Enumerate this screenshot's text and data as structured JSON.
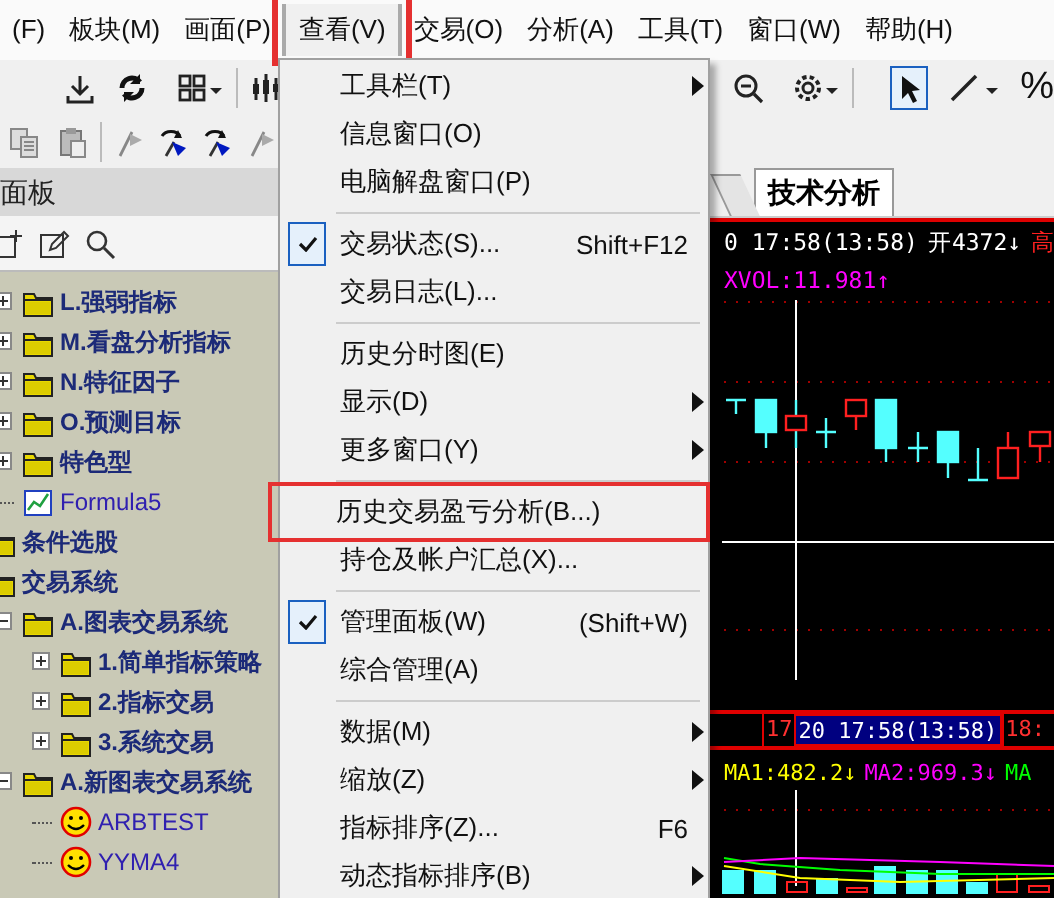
{
  "menubar": [
    {
      "label": "(F)",
      "selected": false,
      "highlighted": false
    },
    {
      "label": "板块(M)",
      "selected": false,
      "highlighted": false
    },
    {
      "label": "画面(P)",
      "selected": false,
      "highlighted": false
    },
    {
      "label": "查看(V)",
      "selected": true,
      "highlighted": true
    },
    {
      "label": "交易(O)",
      "selected": false,
      "highlighted": false
    },
    {
      "label": "分析(A)",
      "selected": false,
      "highlighted": false
    },
    {
      "label": "工具(T)",
      "selected": false,
      "highlighted": false
    },
    {
      "label": "窗口(W)",
      "selected": false,
      "highlighted": false
    },
    {
      "label": "帮助(H)",
      "selected": false,
      "highlighted": false
    }
  ],
  "toolbar": {
    "percent_button": "%"
  },
  "panel": {
    "title": "面板"
  },
  "tree": {
    "continued": [
      {
        "label": "L.强弱指标",
        "kind": "folder",
        "expanded": false
      },
      {
        "label": "M.看盘分析指标",
        "kind": "folder",
        "expanded": false
      },
      {
        "label": "N.特征因子",
        "kind": "folder",
        "expanded": false
      },
      {
        "label": "O.预测目标",
        "kind": "folder",
        "expanded": false
      },
      {
        "label": "特色型",
        "kind": "folder",
        "expanded": false
      },
      {
        "label": "Formula5",
        "kind": "formula"
      }
    ],
    "items": [
      {
        "label": "条件选股",
        "kind": "folder"
      },
      {
        "label": "交易系统",
        "kind": "folder",
        "children": [
          {
            "label": "A.图表交易系统",
            "kind": "folder",
            "expanded": true,
            "children": [
              {
                "label": "1.简单指标策略",
                "kind": "folder",
                "expanded": false
              },
              {
                "label": "2.指标交易",
                "kind": "folder",
                "expanded": false
              },
              {
                "label": "3.系统交易",
                "kind": "folder",
                "expanded": false
              }
            ]
          },
          {
            "label": "A.新图表交易系统",
            "kind": "folder",
            "expanded": true,
            "children": [
              {
                "label": "ARBTEST",
                "kind": "smiley"
              },
              {
                "label": "YYMA4",
                "kind": "smiley"
              }
            ]
          }
        ]
      }
    ]
  },
  "tabs": [
    {
      "label": "技术分析",
      "selected": true
    }
  ],
  "view_menu": {
    "items": [
      {
        "kind": "item",
        "label": "工具栏(T)",
        "submenu": true
      },
      {
        "kind": "item",
        "label": "信息窗口(O)"
      },
      {
        "kind": "item",
        "label": "电脑解盘窗口(P)"
      },
      {
        "kind": "separator"
      },
      {
        "kind": "item",
        "label": "交易状态(S)...",
        "shortcut": "Shift+F12",
        "checked": true
      },
      {
        "kind": "item",
        "label": "交易日志(L)..."
      },
      {
        "kind": "separator"
      },
      {
        "kind": "item",
        "label": "历史分时图(E)"
      },
      {
        "kind": "item",
        "label": "显示(D)",
        "submenu": true
      },
      {
        "kind": "item",
        "label": "更多窗口(Y)",
        "submenu": true
      },
      {
        "kind": "separator"
      },
      {
        "kind": "item",
        "label": "历史交易盈亏分析(B...)",
        "highlighted": true
      },
      {
        "kind": "item",
        "label": "持仓及帐户汇总(X)..."
      },
      {
        "kind": "separator"
      },
      {
        "kind": "item",
        "label": "管理面板(W)",
        "shortcut": "(Shift+W)",
        "checked": true
      },
      {
        "kind": "item",
        "label": "综合管理(A)"
      },
      {
        "kind": "separator"
      },
      {
        "kind": "item",
        "label": "数据(M)",
        "submenu": true
      },
      {
        "kind": "item",
        "label": "缩放(Z)",
        "submenu": true
      },
      {
        "kind": "item",
        "label": "指标排序(Z)...",
        "shortcut": "F6"
      },
      {
        "kind": "item",
        "label": "动态指标排序(B)",
        "submenu": true
      }
    ]
  },
  "chart": {
    "header": [
      {
        "text": "0 17:58(13:58)",
        "color": "#ffffff"
      },
      {
        "text": "开4372↓",
        "color": "#ffffff"
      },
      {
        "text": "高",
        "color": "#ff2020"
      }
    ],
    "indicator": [
      {
        "text": "XVOL:11.981↑",
        "color": "#ff00ff"
      }
    ],
    "axis_labels": [
      {
        "text": "17",
        "selected": false
      },
      {
        "text": "20 17:58(13:58)",
        "selected": true
      },
      {
        "text": "18:",
        "selected": false
      }
    ],
    "ma_labels": [
      {
        "text": "MA1:482.2↓",
        "color": "#ffff00"
      },
      {
        "text": "MA2:969.3↓",
        "color": "#ff00ff"
      },
      {
        "text": "MA",
        "color": "#00ff00"
      }
    ]
  }
}
